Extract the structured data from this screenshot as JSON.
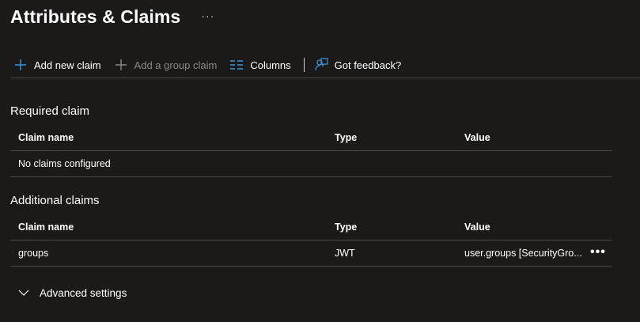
{
  "header": {
    "title": "Attributes & Claims",
    "more_label": "···"
  },
  "toolbar": {
    "add_new_claim": "Add new claim",
    "add_group_claim": "Add a group claim",
    "columns": "Columns",
    "feedback": "Got feedback?",
    "icons": {
      "add_new_claim": "plus-icon",
      "add_group_claim": "plus-icon",
      "columns": "columns-icon",
      "feedback": "feedback-icon"
    },
    "colors": {
      "accent": "#3a96dd",
      "disabled": "#8a8886"
    }
  },
  "required_claim": {
    "title": "Required claim",
    "columns": [
      "Claim name",
      "Type",
      "Value"
    ],
    "empty_message": "No claims configured"
  },
  "additional_claims": {
    "title": "Additional claims",
    "columns": [
      "Claim name",
      "Type",
      "Value"
    ],
    "rows": [
      {
        "claim_name": "groups",
        "type": "JWT",
        "value": "user.groups [SecurityGro...",
        "more_label": "•••"
      }
    ]
  },
  "advanced_settings": {
    "label": "Advanced settings",
    "icon": "chevron-down-icon"
  }
}
